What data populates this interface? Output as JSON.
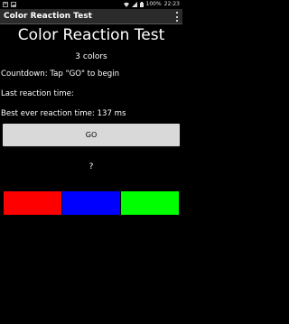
{
  "status_bar": {
    "battery_text": "100%",
    "time": "22:23"
  },
  "app": {
    "title": "Color Reaction Test"
  },
  "main": {
    "title": "Color Reaction Test",
    "colors_count": "3 colors",
    "countdown": "Countdown: Tap \"GO\" to begin",
    "last_reaction": "Last reaction time:",
    "best_reaction": "Best ever reaction time: 137 ms",
    "go_label": "GO",
    "target_color": "?"
  },
  "color_tiles": [
    {
      "name": "red",
      "color": "#ff0000"
    },
    {
      "name": "blue",
      "color": "#0000ff"
    },
    {
      "name": "green",
      "color": "#00ff00"
    }
  ],
  "theme": {
    "background": "#000000",
    "action_bar": "#2b2b2b",
    "button": "#d9d9d9"
  },
  "icons": {
    "status_left": [
      "notification-icon",
      "image-icon"
    ],
    "status_right": [
      "wifi-icon",
      "signal-icon",
      "battery-icon"
    ],
    "action_bar": [
      "overflow-menu-icon"
    ]
  }
}
